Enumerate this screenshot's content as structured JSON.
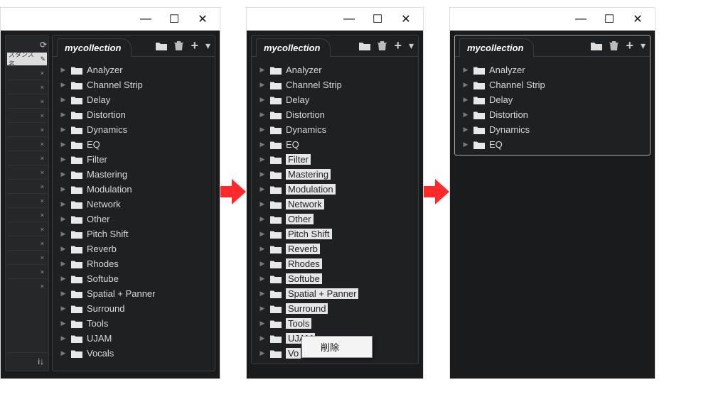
{
  "titlebar": {
    "minimize": "—",
    "maximize": "☐",
    "close": "✕"
  },
  "toolbar": {
    "tab_label": "mycollection",
    "folder_icon": "folder",
    "trash_icon": "trash",
    "add_icon": "+",
    "expand_icon": "▾"
  },
  "sidebar": {
    "instance_label": "スタンス名",
    "refresh_icon": "⟳",
    "info_icon": "i↓",
    "edit_icon": "✎"
  },
  "context_menu": {
    "delete": "削除"
  },
  "arrows": {
    "alt": "next"
  },
  "panels": [
    {
      "items": [
        {
          "label": "Analyzer",
          "selected": false
        },
        {
          "label": "Channel Strip",
          "selected": false
        },
        {
          "label": "Delay",
          "selected": false
        },
        {
          "label": "Distortion",
          "selected": false
        },
        {
          "label": "Dynamics",
          "selected": false
        },
        {
          "label": "EQ",
          "selected": false
        },
        {
          "label": "Filter",
          "selected": false
        },
        {
          "label": "Mastering",
          "selected": false
        },
        {
          "label": "Modulation",
          "selected": false
        },
        {
          "label": "Network",
          "selected": false
        },
        {
          "label": "Other",
          "selected": false
        },
        {
          "label": "Pitch Shift",
          "selected": false
        },
        {
          "label": "Reverb",
          "selected": false
        },
        {
          "label": "Rhodes",
          "selected": false
        },
        {
          "label": "Softube",
          "selected": false
        },
        {
          "label": "Spatial + Panner",
          "selected": false
        },
        {
          "label": "Surround",
          "selected": false
        },
        {
          "label": "Tools",
          "selected": false
        },
        {
          "label": "UJAM",
          "selected": false
        },
        {
          "label": "Vocals",
          "selected": false
        }
      ]
    },
    {
      "items": [
        {
          "label": "Analyzer",
          "selected": false
        },
        {
          "label": "Channel Strip",
          "selected": false
        },
        {
          "label": "Delay",
          "selected": false
        },
        {
          "label": "Distortion",
          "selected": false
        },
        {
          "label": "Dynamics",
          "selected": false
        },
        {
          "label": "EQ",
          "selected": false
        },
        {
          "label": "Filter",
          "selected": true
        },
        {
          "label": "Mastering",
          "selected": true
        },
        {
          "label": "Modulation",
          "selected": true
        },
        {
          "label": "Network",
          "selected": true
        },
        {
          "label": "Other",
          "selected": true
        },
        {
          "label": "Pitch Shift",
          "selected": true
        },
        {
          "label": "Reverb",
          "selected": true
        },
        {
          "label": "Rhodes",
          "selected": true
        },
        {
          "label": "Softube",
          "selected": true
        },
        {
          "label": "Spatial + Panner",
          "selected": true
        },
        {
          "label": "Surround",
          "selected": true
        },
        {
          "label": "Tools",
          "selected": true
        },
        {
          "label": "UJAM",
          "selected": true
        },
        {
          "label": "Vo",
          "selected": true
        }
      ],
      "context_menu": true
    },
    {
      "items": [
        {
          "label": "Analyzer",
          "selected": false
        },
        {
          "label": "Channel Strip",
          "selected": false
        },
        {
          "label": "Delay",
          "selected": false
        },
        {
          "label": "Distortion",
          "selected": false
        },
        {
          "label": "Dynamics",
          "selected": false
        },
        {
          "label": "EQ",
          "selected": false
        }
      ]
    }
  ]
}
